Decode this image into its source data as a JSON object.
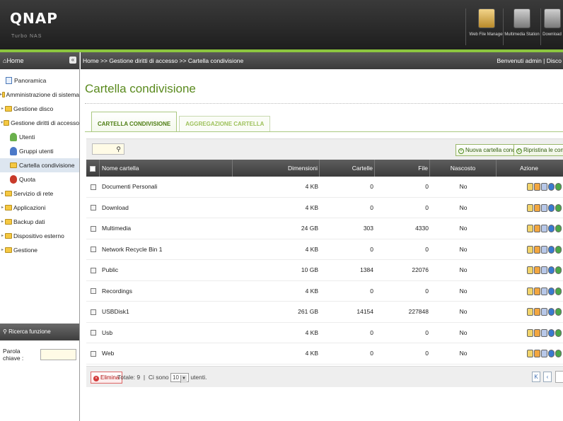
{
  "brand": {
    "logo": "QNAP",
    "subtitle": "Turbo NAS"
  },
  "header_apps": [
    {
      "label": "Web File Manager",
      "icon": "file-manager-icon"
    },
    {
      "label": "Multimedia Station",
      "icon": "multimedia-station-icon"
    },
    {
      "label": "Download",
      "icon": "download-station-icon"
    }
  ],
  "sidebar": {
    "title": "Home",
    "collapse_glyph": "«",
    "items": [
      {
        "label": "Panoramica",
        "type": "doc"
      },
      {
        "label": "Amministrazione di sistema",
        "type": "folder"
      },
      {
        "label": "Gestione disco",
        "type": "folder"
      },
      {
        "label": "Gestione diritti di accesso",
        "type": "folder-open"
      },
      {
        "label": "Utenti",
        "type": "sub"
      },
      {
        "label": "Gruppi utenti",
        "type": "sub"
      },
      {
        "label": "Cartella condivisione",
        "type": "sub",
        "selected": true
      },
      {
        "label": "Quota",
        "type": "sub"
      },
      {
        "label": "Servizio di rete",
        "type": "folder"
      },
      {
        "label": "Applicazioni",
        "type": "folder"
      },
      {
        "label": "Backup dati",
        "type": "folder"
      },
      {
        "label": "Dispositivo esterno",
        "type": "folder"
      },
      {
        "label": "Gestione",
        "type": "folder"
      }
    ],
    "search": {
      "title": "Ricerca funzione",
      "keyword_label": "Parola chiave :"
    }
  },
  "breadcrumb": "Home >> Gestione diritti di accesso >> Cartella condivisione",
  "welcome": "Benvenuti admin | Disco",
  "page_title": "Cartella condivisione",
  "tabs": [
    {
      "label": "CARTELLA CONDIVISIONE",
      "active": true
    },
    {
      "label": "AGGREGAZIONE CARTELLA",
      "active": false
    }
  ],
  "toolbar": {
    "new_share_label": "Nuova cartella condivisione",
    "restore_label": "Ripristina le condivisioni"
  },
  "table": {
    "columns": [
      "Nome cartella",
      "Dimensioni",
      "Cartelle",
      "File",
      "Nascosto",
      "Azione"
    ],
    "rows": [
      {
        "name": "Documenti Personali",
        "size": "4 KB",
        "folders": "0",
        "files": "0",
        "hidden": "No"
      },
      {
        "name": "Download",
        "size": "4 KB",
        "folders": "0",
        "files": "0",
        "hidden": "No"
      },
      {
        "name": "Multimedia",
        "size": "24 GB",
        "folders": "303",
        "files": "4330",
        "hidden": "No"
      },
      {
        "name": "Network Recycle Bin 1",
        "size": "4 KB",
        "folders": "0",
        "files": "0",
        "hidden": "No"
      },
      {
        "name": "Public",
        "size": "10 GB",
        "folders": "1384",
        "files": "22076",
        "hidden": "No"
      },
      {
        "name": "Recordings",
        "size": "4 KB",
        "folders": "0",
        "files": "0",
        "hidden": "No"
      },
      {
        "name": "USBDisk1",
        "size": "261 GB",
        "folders": "14154",
        "files": "227848",
        "hidden": "No"
      },
      {
        "name": "Usb",
        "size": "4 KB",
        "folders": "0",
        "files": "0",
        "hidden": "No"
      },
      {
        "name": "Web",
        "size": "4 KB",
        "folders": "0",
        "files": "0",
        "hidden": "No"
      }
    ],
    "action_icons": [
      "edit-icon",
      "user-permission-icon",
      "nfs-icon",
      "web-access-icon",
      "refresh-icon"
    ]
  },
  "footer": {
    "delete_label": "Elimina",
    "total_label": "Totale: 9",
    "separator": "|",
    "ci_sono": "Ci sono",
    "per_page": "10",
    "utenti": "utenti.",
    "first_glyph": "K",
    "prev_glyph": "‹"
  }
}
